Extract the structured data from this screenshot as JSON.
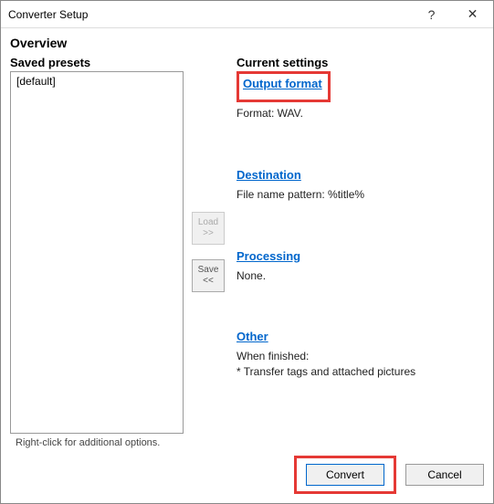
{
  "titlebar": {
    "title": "Converter Setup",
    "help": "?",
    "close": "✕"
  },
  "overview_label": "Overview",
  "left": {
    "heading": "Saved presets",
    "items": [
      "[default]"
    ],
    "hint": "Right-click for additional options."
  },
  "mid": {
    "load_label": "Load",
    "load_arrows": ">>",
    "save_label": "Save",
    "save_arrows": "<<"
  },
  "right": {
    "heading": "Current settings",
    "output_format": {
      "link": "Output format",
      "detail": "Format: WAV."
    },
    "destination": {
      "link": "Destination",
      "detail": "File name pattern: %title%"
    },
    "processing": {
      "link": "Processing",
      "detail": "None."
    },
    "other": {
      "link": "Other",
      "line1": "When finished:",
      "line2": "* Transfer tags and attached pictures"
    }
  },
  "footer": {
    "convert": "Convert",
    "cancel": "Cancel"
  }
}
